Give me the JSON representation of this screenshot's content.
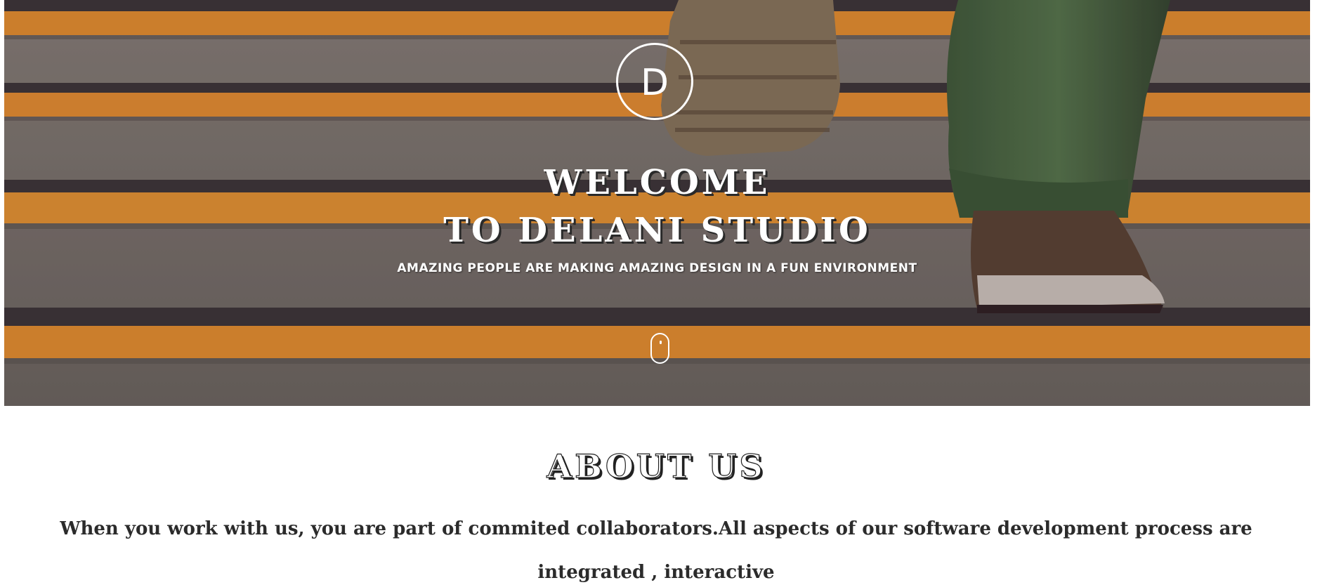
{
  "hero": {
    "logo_letter": "D",
    "title_line1": "WELCOME",
    "title_line2": "TO DELANI STUDIO",
    "subtitle": "AMAZING PEOPLE ARE MAKING AMAZING DESIGN IN A FUN ENVIRONMENT",
    "scroll_icon": "mouse-scroll-icon"
  },
  "about": {
    "title": "ABOUT US",
    "text": "When you work with us, you are part of commited collaborators.All aspects of our software development process are integrated , interactive"
  },
  "colors": {
    "stripe_orange": "#f0962e",
    "step_gray": "#807a72",
    "text_dark": "#2b2b2b"
  }
}
